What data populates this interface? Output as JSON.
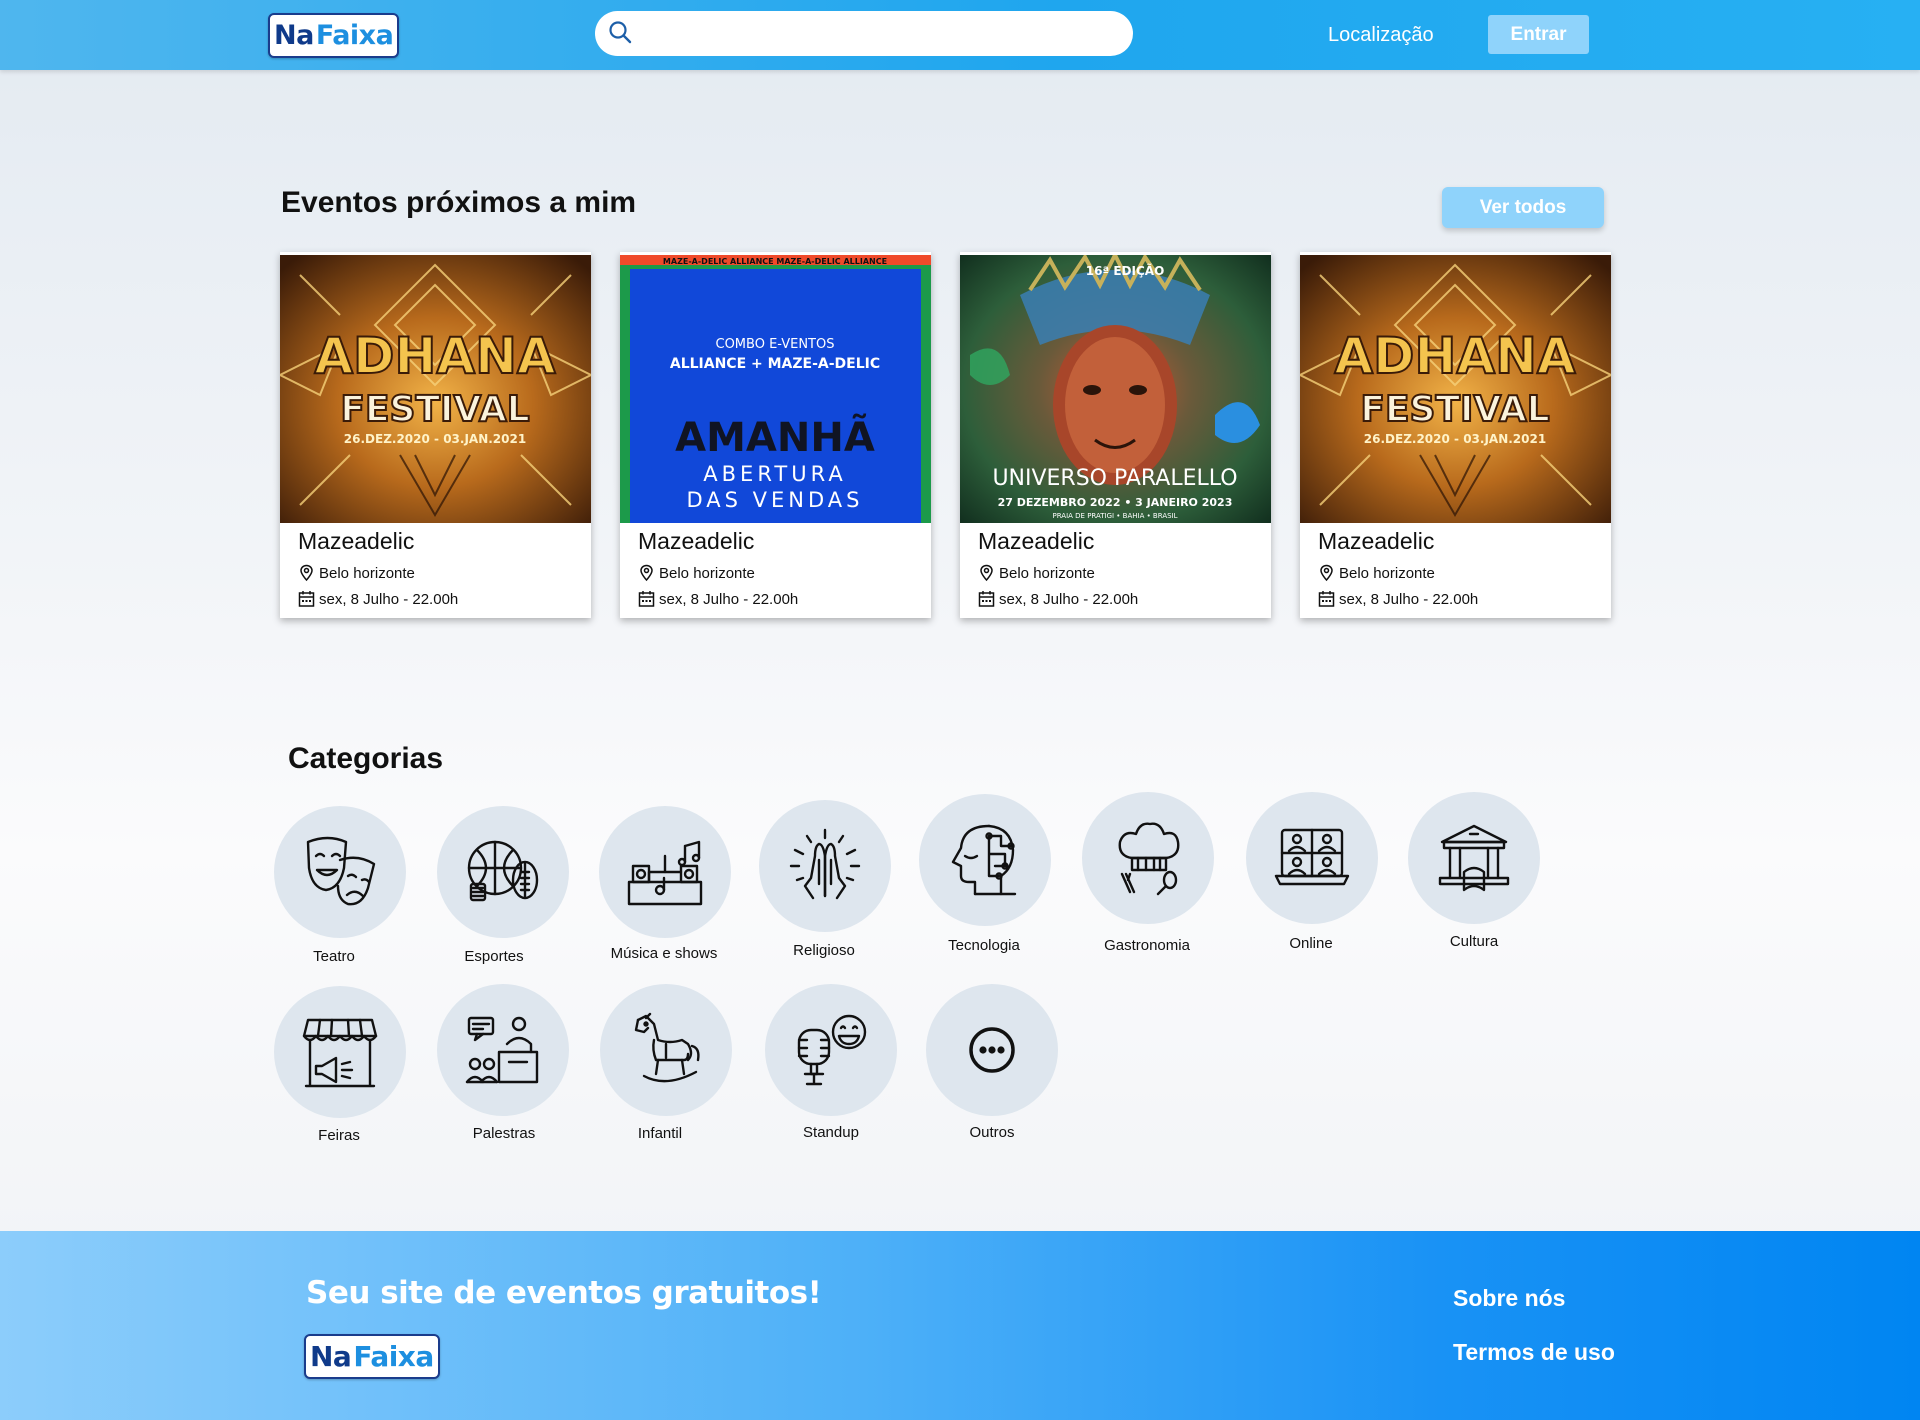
{
  "header": {
    "logo": {
      "na": "Na",
      "faixa": "Faixa"
    },
    "search_placeholder": "",
    "location_label": "Localização",
    "login_label": "Entrar"
  },
  "events": {
    "title": "Eventos próximos a mim",
    "see_all_label": "Ver todos",
    "cards": [
      {
        "name": "Mazeadelic",
        "location": "Belo horizonte",
        "date": "sex, 8 Julho - 22.00h"
      },
      {
        "name": "Mazeadelic",
        "location": "Belo horizonte",
        "date": "sex, 8 Julho - 22.00h"
      },
      {
        "name": "Mazeadelic",
        "location": "Belo horizonte",
        "date": "sex, 8 Julho - 22.00h"
      },
      {
        "name": "Mazeadelic",
        "location": "Belo horizonte",
        "date": "sex, 8 Julho - 22.00h"
      }
    ],
    "posters": {
      "adhana": {
        "line1": "ADHANA",
        "line2": "FESTIVAL",
        "dates": "26.DEZ.2020 - 03.JAN.2021"
      },
      "maze": {
        "top": "COMBO E-VENTOS",
        "sub": "ALLIANCE + MAZE-A-DELIC",
        "big": "AMANHÃ",
        "line2": "ABERTURA",
        "line3": "DAS VENDAS",
        "border": "MAZE-A-DELIC  ALLIANCE  MAZE-A-DELIC  ALLIANCE"
      },
      "universo": {
        "edition": "16ª EDIÇÃO",
        "name": "UNIVERSO PARALELLO",
        "dates": "27 DEZEMBRO 2022 • 3 JANEIRO 2023",
        "place": "PRAIA DE PRATIGI • BAHIA • BRASIL"
      }
    }
  },
  "categories": {
    "title": "Categorias",
    "items": [
      {
        "label": "Teatro",
        "icon": "theater-masks-icon"
      },
      {
        "label": "Esportes",
        "icon": "sports-balls-icon"
      },
      {
        "label": "Música e shows",
        "icon": "music-stage-icon"
      },
      {
        "label": "Religioso",
        "icon": "praying-hands-icon"
      },
      {
        "label": "Tecnologia",
        "icon": "tech-head-icon"
      },
      {
        "label": "Gastronomia",
        "icon": "chef-hat-icon"
      },
      {
        "label": "Online",
        "icon": "video-call-laptop-icon"
      },
      {
        "label": "Cultura",
        "icon": "museum-icon"
      },
      {
        "label": "Feiras",
        "icon": "market-stall-icon"
      },
      {
        "label": "Palestras",
        "icon": "lecture-icon"
      },
      {
        "label": "Infantil",
        "icon": "rocking-horse-icon"
      },
      {
        "label": "Standup",
        "icon": "microphone-laugh-icon"
      },
      {
        "label": "Outros",
        "icon": "more-dots-icon"
      }
    ]
  },
  "footer": {
    "tagline": "Seu site de eventos gratuitos!",
    "logo": {
      "na": "Na",
      "faixa": "Faixa"
    },
    "about_label": "Sobre nós",
    "terms_label": "Termos de uso"
  },
  "colors": {
    "header_blue": "#1fa6ee",
    "button_light_blue": "#8fd3fb",
    "category_circle": "#dee6ee",
    "footer_blue": "#0085f2"
  }
}
